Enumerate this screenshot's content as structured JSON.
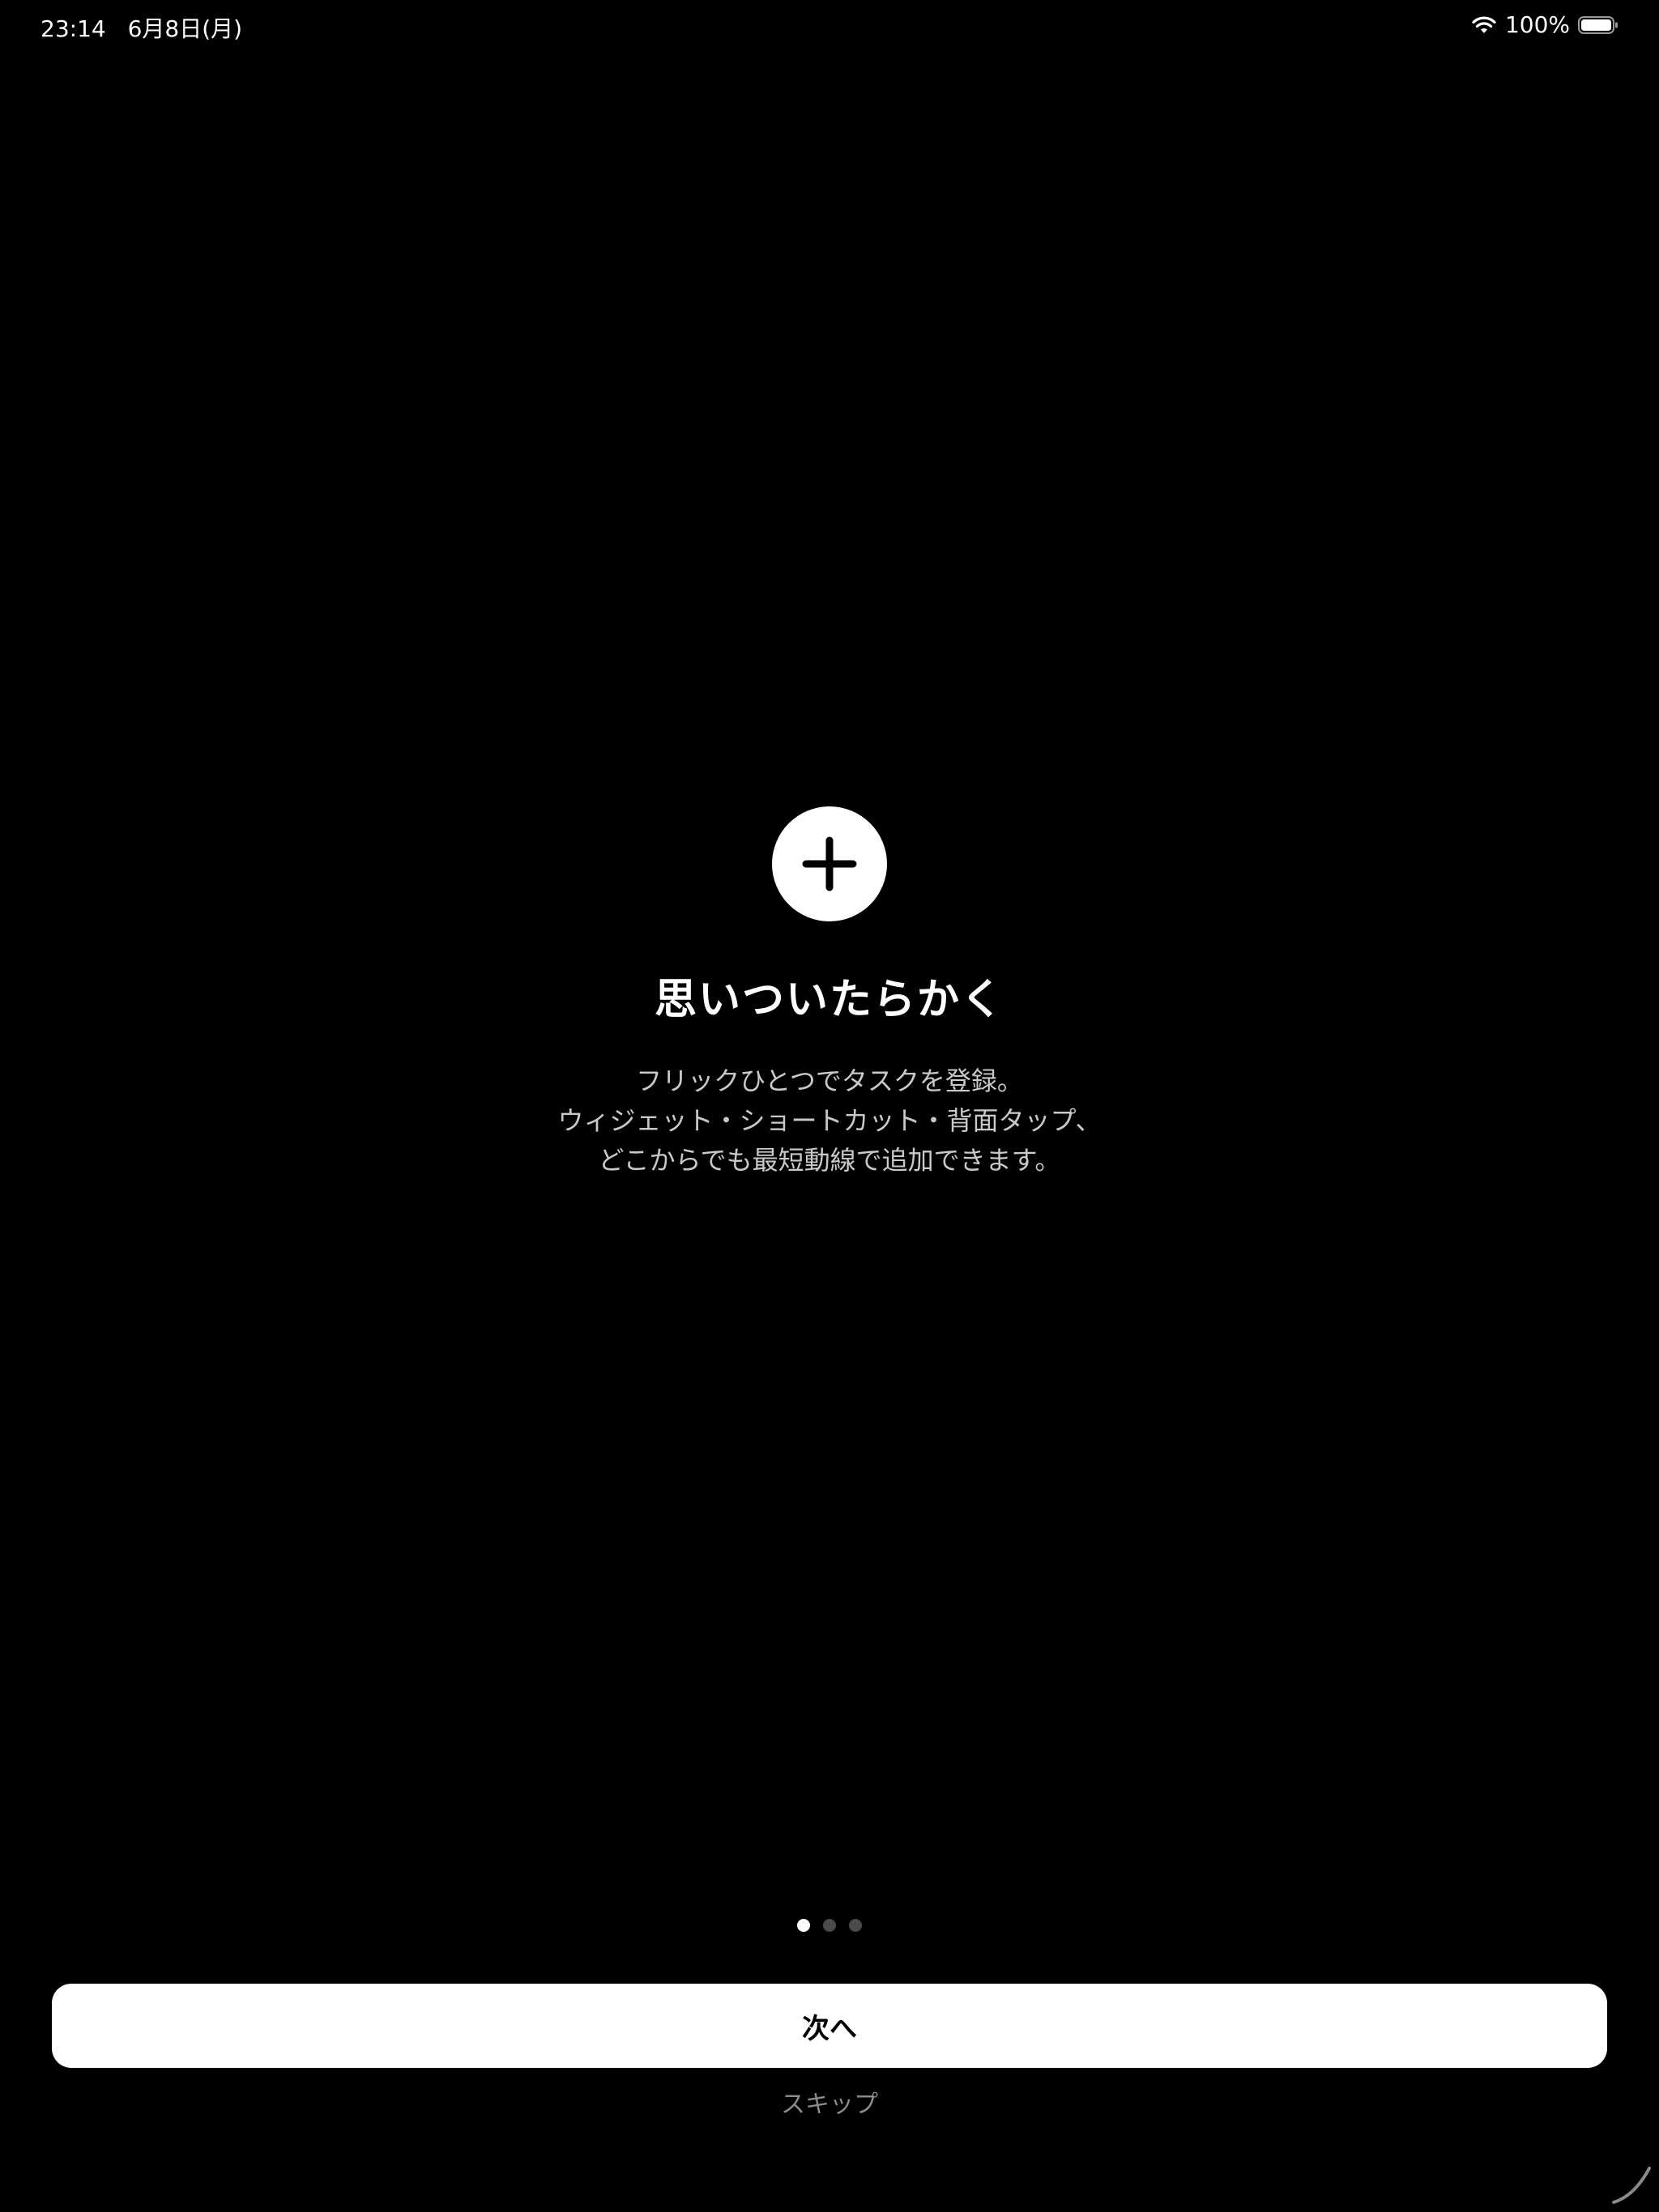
{
  "status_bar": {
    "time": "23:14",
    "date": "6月8日(月)",
    "battery": "100%"
  },
  "onboarding": {
    "icon": "plus-icon",
    "title": "思いついたらかく",
    "description_lines": [
      "フリックひとつでタスクを登録。",
      "ウィジェット・ショートカット・背面タップ、",
      "どこからでも最短動線で追加できます。"
    ],
    "page_indicator": {
      "current": 1,
      "total": 3
    },
    "next_label": "次へ",
    "skip_label": "スキップ"
  },
  "colors": {
    "background": "#000000",
    "primary_button": "#ffffff",
    "description_text": "#c9c9c9",
    "skip_text": "#8c8c8c",
    "dot_inactive": "#4a4a4a"
  }
}
